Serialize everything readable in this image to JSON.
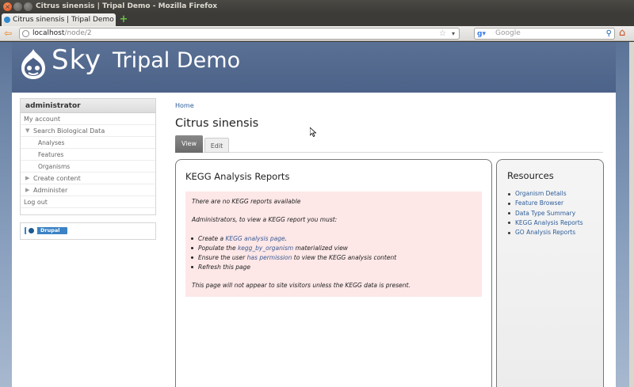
{
  "window": {
    "title": "Citrus sinensis | Tripal Demo - Mozilla Firefox",
    "tab_label": "Citrus sinensis | Tripal Demo",
    "new_tab": "+"
  },
  "navbar": {
    "url_host": "localhost",
    "url_path": "/node/2",
    "search_placeholder": "Google"
  },
  "site": {
    "logo_text": "Sky",
    "name": "Tripal Demo"
  },
  "sidebar": {
    "block_title": "administrator",
    "items": [
      {
        "label": "My account"
      },
      {
        "label": "Search Biological Data"
      },
      {
        "label": "Analyses"
      },
      {
        "label": "Features"
      },
      {
        "label": "Organisms"
      },
      {
        "label": "Create content"
      },
      {
        "label": "Administer"
      },
      {
        "label": "Log out"
      }
    ],
    "drupal_badge": "Drupal"
  },
  "main": {
    "breadcrumb": "Home",
    "page_title": "Citrus sinensis",
    "tabs": [
      {
        "label": "View"
      },
      {
        "label": "Edit"
      }
    ],
    "box_title": "KEGG Analysis Reports",
    "notice": {
      "p1": "There are no KEGG reports available",
      "p2": "Administrators, to view a KEGG report you must:",
      "li1_pre": "Create a ",
      "li1_link": "KEGG analysis page",
      "li1_post": ".",
      "li2_pre": "Populate the ",
      "li2_link": "kegg_by_organism",
      "li2_post": " materialized view",
      "li3_pre": "Ensure the user ",
      "li3_link": "has permission",
      "li3_post": " to view the KEGG analysis content",
      "li4": "Refresh this page",
      "p3": "This page will not appear to site visitors unless the KEGG data is present."
    }
  },
  "resources": {
    "title": "Resources",
    "items": [
      {
        "label": "Organism Details"
      },
      {
        "label": "Feature Browser"
      },
      {
        "label": "Data Type Summary"
      },
      {
        "label": "KEGG Analysis Reports"
      },
      {
        "label": "GO Analysis Reports"
      }
    ]
  }
}
